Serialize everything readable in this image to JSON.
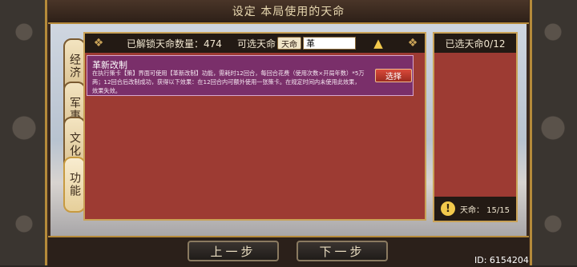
{
  "window": {
    "title": "设定 本局使用的天命"
  },
  "tabs": [
    {
      "label": "经济",
      "active": false
    },
    {
      "label": "军事",
      "active": false
    },
    {
      "label": "文化",
      "active": false
    },
    {
      "label": "功能",
      "active": true
    }
  ],
  "main": {
    "unlocked_label": "已解锁天命数量：474",
    "select_label": "可选天命",
    "filter_value": "天命",
    "search_value": "革",
    "card": {
      "title": "革新改制",
      "description": "在执行策卡【策】界面可使用【革新改制】功能，需耗时12回合，每回合花费（使用次数×开局年数）*5万两；12回合后改制成功，获得以下效果：在12回合内可额外使用一张策卡。在规定时间内未使用此效果，效果失效。",
      "button_label": "选择"
    }
  },
  "right_panel": {
    "title": "已选天命0/12",
    "quota": "天命：  15/15"
  },
  "bottom": {
    "prev_label": "上一步",
    "next_label": "下一步",
    "player_id": "ID: 6154204"
  },
  "icons": [
    "search-icon",
    "dragon-ornament-icon",
    "warning-icon"
  ],
  "colors": {
    "panel_red": "#9d3b33",
    "card_purple": "#7a2f6a",
    "gold_border": "#c9a257"
  }
}
